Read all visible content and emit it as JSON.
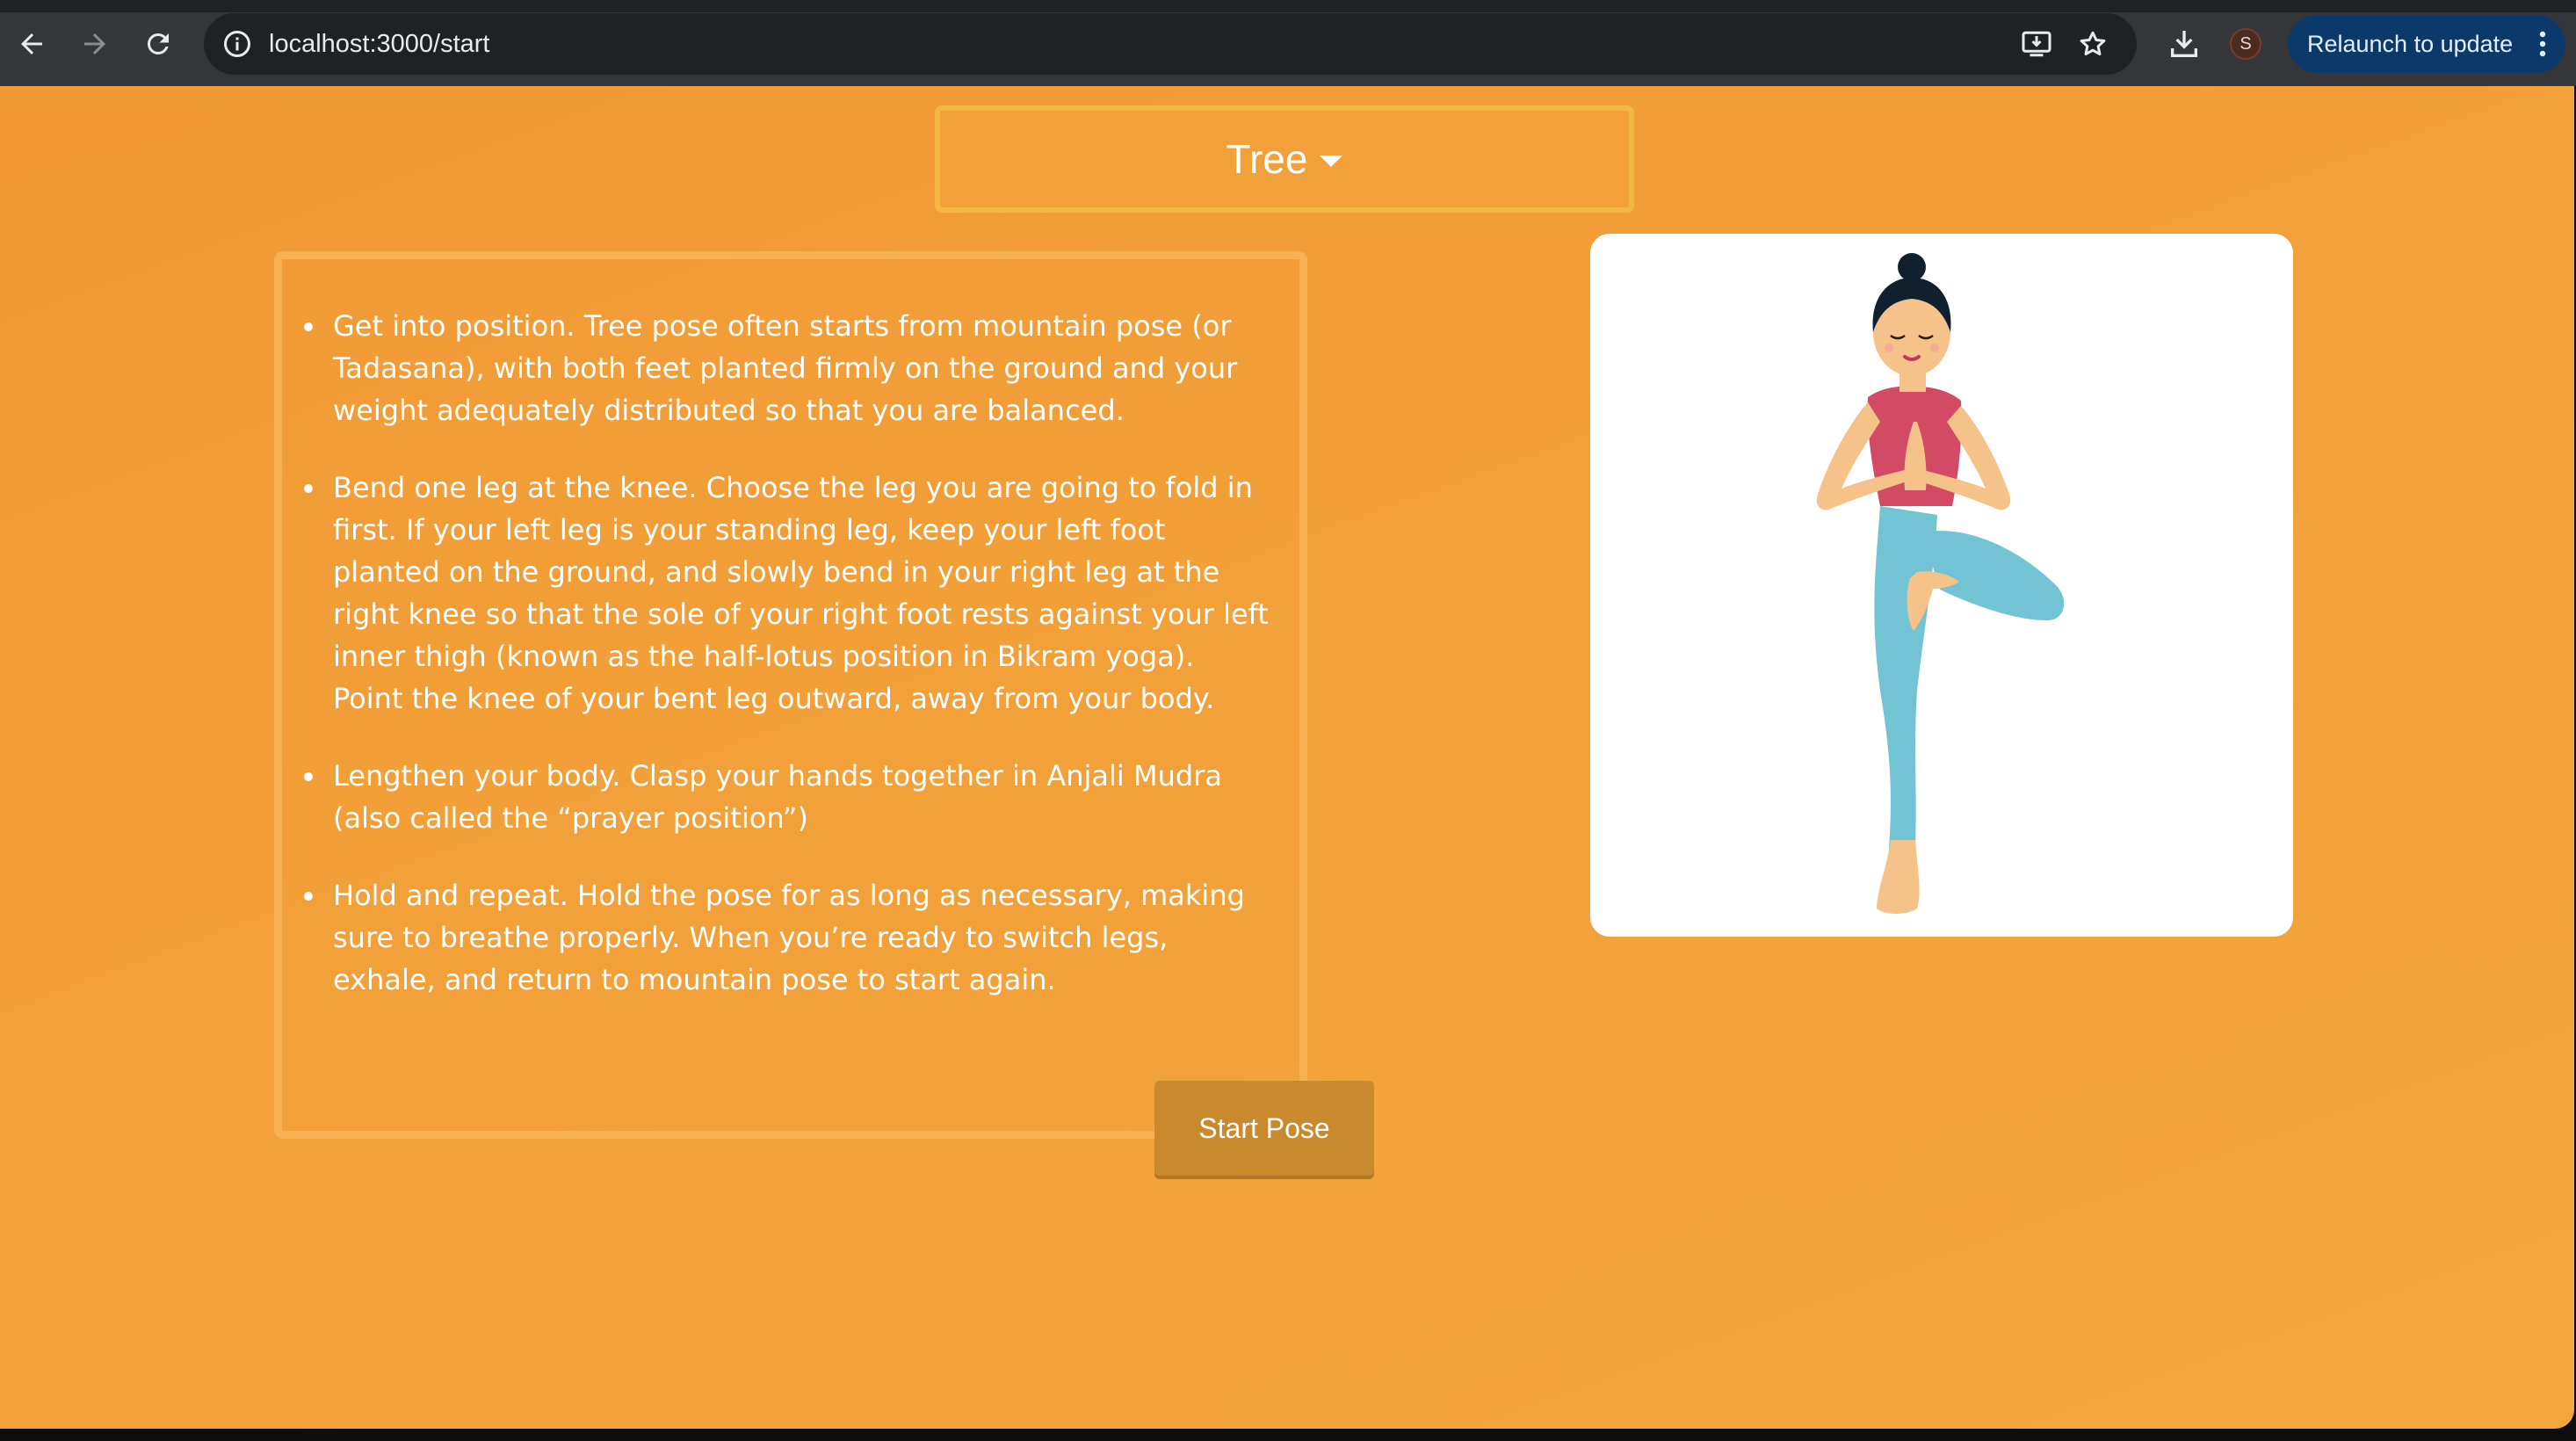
{
  "browser": {
    "url": "localhost:3000/start",
    "profile_initial": "S",
    "relaunch_label": "Relaunch to update",
    "icons": [
      "back-arrow-icon",
      "forward-arrow-icon",
      "reload-icon",
      "site-info-icon",
      "install-app-icon",
      "bookmark-star-icon",
      "download-icon",
      "more-vertical-icon"
    ]
  },
  "page": {
    "pose_select": {
      "selected": "Tree"
    },
    "instructions": [
      "Get into position. Tree pose often starts from mountain pose (or Tadasana), with both feet planted firmly on the ground and your weight adequately distributed so that you are balanced.",
      "Bend one leg at the knee. Choose the leg you are going to fold in first. If your left leg is your standing leg, keep your left foot planted on the ground, and slowly bend in your right leg at the right knee so that the sole of your right foot rests against your left inner thigh (known as the half-lotus position in Bikram yoga). Point the knee of your bent leg outward, away from your body.",
      "Lengthen your body. Clasp your hands together in Anjali Mudra (also called the “prayer position”)",
      "Hold and repeat. Hold the pose for as long as necessary, making sure to breathe properly. When you’re ready to switch legs, exhale, and return to mountain pose to start again."
    ],
    "start_button": "Start Pose"
  },
  "colors": {
    "page_background": "#f2a03a",
    "select_border": "#f5b743",
    "panel_border": "#f6b252",
    "button": "#c98a2e",
    "figure_top": "#d24a64",
    "figure_pants": "#72c3d4",
    "figure_skin": "#f5c28a",
    "figure_hair": "#10202e"
  }
}
